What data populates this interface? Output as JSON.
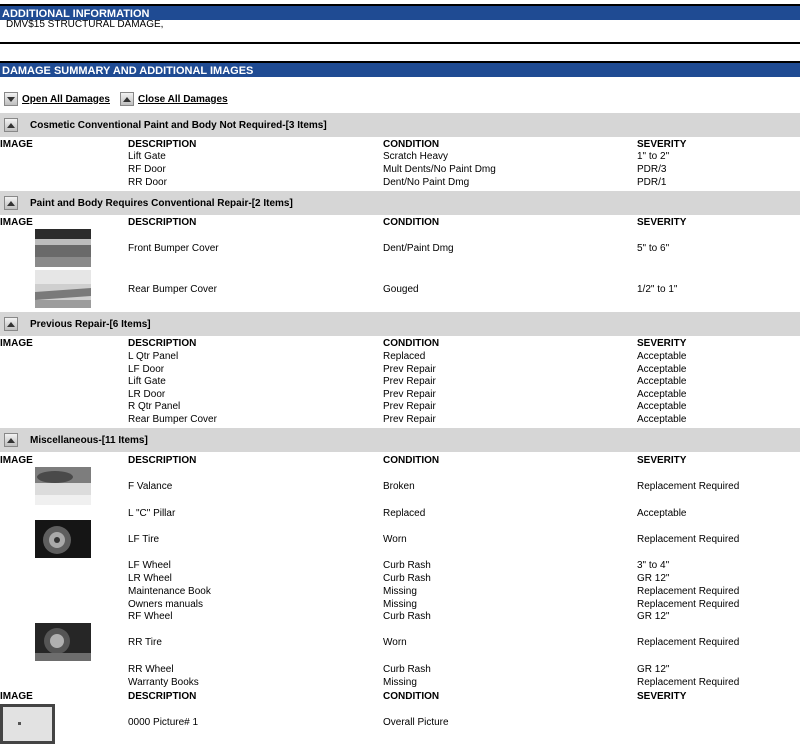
{
  "additional_info": {
    "title": "ADDITIONAL INFORMATION",
    "text": "DMV$15 STRUCTURAL DAMAGE,"
  },
  "damage_summary": {
    "title": "DAMAGE SUMMARY AND ADDITIONAL IMAGES",
    "open_all": "Open All Damages",
    "close_all": "Close All Damages"
  },
  "headers": {
    "image": "IMAGE",
    "description": "DESCRIPTION",
    "condition": "CONDITION",
    "severity": "SEVERITY"
  },
  "sections": [
    {
      "title": "Cosmetic Conventional Paint and Body Not Required-[3 Items]",
      "rows": [
        {
          "description": "Lift Gate",
          "condition": "Scratch Heavy",
          "severity": "1\" to 2\""
        },
        {
          "description": "RF Door",
          "condition": "Mult Dents/No Paint Dmg",
          "severity": "PDR/3"
        },
        {
          "description": "RR Door",
          "condition": "Dent/No Paint Dmg",
          "severity": "PDR/1"
        }
      ]
    },
    {
      "title": "Paint and Body Requires Conventional Repair-[2 Items]",
      "rows": [
        {
          "description": "Front Bumper Cover",
          "condition": "Dent/Paint Dmg",
          "severity": "5\" to 6\""
        },
        {
          "description": "Rear Bumper Cover",
          "condition": "Gouged",
          "severity": "1/2\" to 1\""
        }
      ]
    },
    {
      "title": "Previous Repair-[6 Items]",
      "rows": [
        {
          "description": "L Qtr Panel",
          "condition": "Replaced",
          "severity": "Acceptable"
        },
        {
          "description": "LF Door",
          "condition": "Prev Repair",
          "severity": "Acceptable"
        },
        {
          "description": "Lift Gate",
          "condition": "Prev Repair",
          "severity": "Acceptable"
        },
        {
          "description": "LR Door",
          "condition": "Prev Repair",
          "severity": "Acceptable"
        },
        {
          "description": "R Qtr Panel",
          "condition": "Prev Repair",
          "severity": "Acceptable"
        },
        {
          "description": "Rear Bumper Cover",
          "condition": "Prev Repair",
          "severity": "Acceptable"
        }
      ]
    },
    {
      "title": "Miscellaneous-[11 Items]",
      "rows": [
        {
          "description": "F Valance",
          "condition": "Broken",
          "severity": "Replacement Required"
        },
        {
          "description": "L \"C\" Pillar",
          "condition": "Replaced",
          "severity": "Acceptable"
        },
        {
          "description": "LF Tire",
          "condition": "Worn",
          "severity": "Replacement Required"
        },
        {
          "description": "LF Wheel",
          "condition": "Curb Rash",
          "severity": "3\" to 4\""
        },
        {
          "description": "LR Wheel",
          "condition": "Curb Rash",
          "severity": "GR 12\""
        },
        {
          "description": "Maintenance Book",
          "condition": "Missing",
          "severity": "Replacement Required"
        },
        {
          "description": "Owners manuals",
          "condition": "Missing",
          "severity": "Replacement Required"
        },
        {
          "description": "RF Wheel",
          "condition": "Curb Rash",
          "severity": "GR 12\""
        },
        {
          "description": "RR Tire",
          "condition": "Worn",
          "severity": "Replacement Required"
        },
        {
          "description": "RR Wheel",
          "condition": "Curb Rash",
          "severity": "GR 12\""
        },
        {
          "description": "Warranty Books",
          "condition": "Missing",
          "severity": "Replacement Required"
        }
      ]
    }
  ],
  "pictures": {
    "rows": [
      {
        "description": "0000 Picture# 1",
        "condition": "Overall Picture",
        "severity": ""
      }
    ]
  }
}
